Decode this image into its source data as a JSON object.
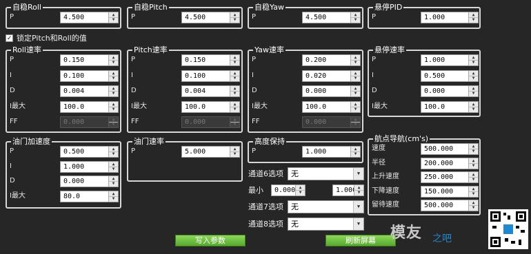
{
  "groups": {
    "stab_roll": {
      "title": "自稳Roll",
      "p_label": "P",
      "p": "4.500"
    },
    "stab_pitch": {
      "title": "自稳Pitch",
      "p_label": "P",
      "p": "4.500"
    },
    "stab_yaw": {
      "title": "自稳Yaw",
      "p_label": "P",
      "p": "4.500"
    },
    "loiter_pid": {
      "title": "悬停PID",
      "p_label": "P",
      "p": "1.000"
    },
    "lock_label": "锁定Pitch和Roll的值",
    "roll_rate": {
      "title": "Roll速率",
      "labels": [
        "P",
        "I",
        "D",
        "I最大",
        "FF"
      ],
      "values": [
        "0.150",
        "0.100",
        "0.004",
        "100.0",
        "0.000"
      ]
    },
    "pitch_rate": {
      "title": "Pitch速率",
      "labels": [
        "P",
        "I",
        "D",
        "I最大",
        "FF"
      ],
      "values": [
        "0.150",
        "0.100",
        "0.004",
        "100.0",
        "0.000"
      ]
    },
    "yaw_rate": {
      "title": "Yaw速率",
      "labels": [
        "P",
        "I",
        "D",
        "I最大",
        "FF"
      ],
      "values": [
        "0.200",
        "0.020",
        "0.000",
        "100.0",
        "0.000"
      ]
    },
    "loiter_rate": {
      "title": "悬停速率",
      "labels": [
        "P",
        "I",
        "D",
        "I最大"
      ],
      "values": [
        "1.000",
        "0.500",
        "0.000",
        "100.0"
      ]
    },
    "throttle_accel": {
      "title": "油门加速度",
      "labels": [
        "P",
        "I",
        "D",
        "I最大"
      ],
      "values": [
        "0.500",
        "1.000",
        "0.000",
        "80.0"
      ]
    },
    "throttle_rate": {
      "title": "油门速率",
      "p_label": "P",
      "p": "5.000"
    },
    "alt_hold": {
      "title": "高度保持",
      "p_label": "P",
      "p": "1.000"
    },
    "wpnav": {
      "title": "航点导航(cm's)",
      "labels": [
        "速度",
        "半径",
        "上升速度",
        "下降速度",
        "留待速度"
      ],
      "values": [
        "500.000",
        "200.000",
        "250.000",
        "150.000",
        "500.000"
      ]
    }
  },
  "options": {
    "ch6_label": "通道6选项",
    "ch6_value": "无",
    "min_label": "最小",
    "min_value": "0.000",
    "max_value": "1.000",
    "ch7_label": "通道7选项",
    "ch7_value": "无",
    "ch8_label": "通道8选项",
    "ch8_value": "无"
  },
  "buttons": {
    "write": "写入参数",
    "refresh": "刷新屏幕"
  },
  "watermark": {
    "logo": "模友",
    "logo_suffix": "之吧"
  },
  "colors": {
    "background": "#262626",
    "border": "#d8d8d8",
    "button": "#6ec040"
  }
}
